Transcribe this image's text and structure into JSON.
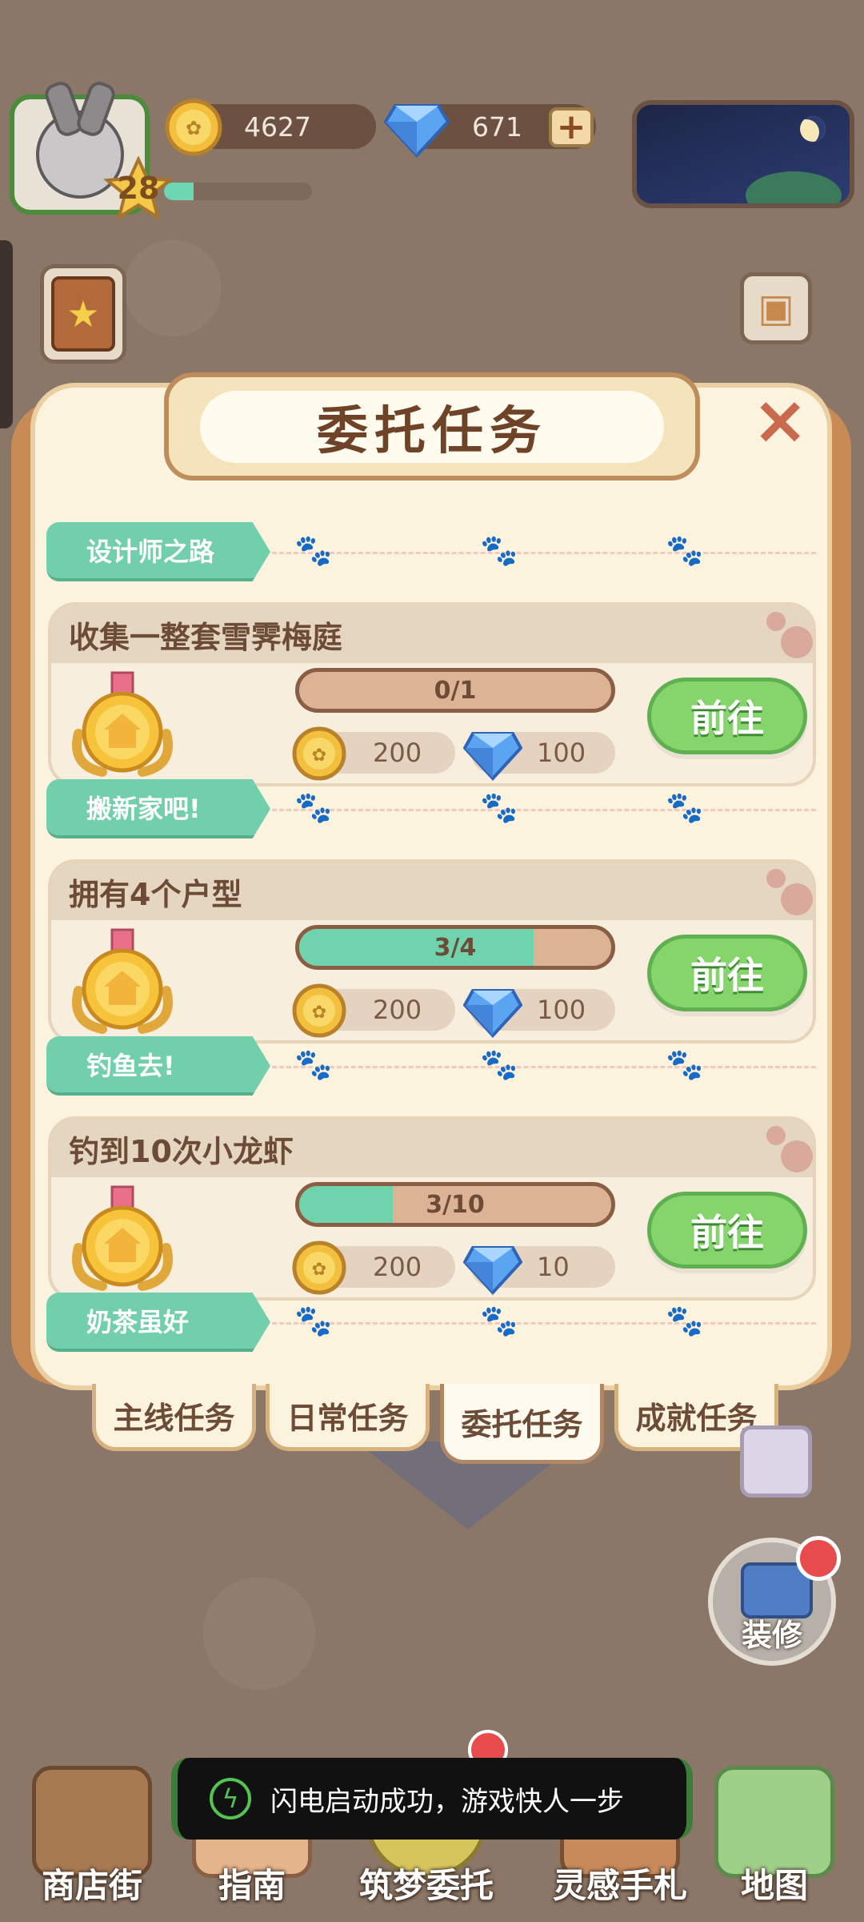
{
  "hud": {
    "level": "28",
    "xp_progress": 0.2,
    "coins": "4627",
    "gems": "671",
    "plus_label": "+"
  },
  "panel": {
    "title": "委托任务",
    "close_label": "×"
  },
  "sections": [
    {
      "tag": "设计师之路"
    },
    {
      "tag": "搬新家吧!"
    },
    {
      "tag": "钓鱼去!"
    },
    {
      "tag": "奶茶虽好"
    }
  ],
  "tasks": [
    {
      "title": "收集一整套雪霁梅庭",
      "progress_text": "0/1",
      "progress": 0.0,
      "coin_reward": "200",
      "gem_reward": "100",
      "button": "前往"
    },
    {
      "title": "拥有4个户型",
      "progress_text": "3/4",
      "progress": 0.75,
      "coin_reward": "200",
      "gem_reward": "100",
      "button": "前往"
    },
    {
      "title": "钓到10次小龙虾",
      "progress_text": "3/10",
      "progress": 0.3,
      "coin_reward": "200",
      "gem_reward": "10",
      "button": "前往"
    }
  ],
  "tabs": [
    {
      "label": "主线任务"
    },
    {
      "label": "日常任务"
    },
    {
      "label": "委托任务",
      "active": true
    },
    {
      "label": "成就任务"
    }
  ],
  "side": {
    "decorate_label": "装修"
  },
  "nav": [
    {
      "label": "商店街",
      "icon": "shop-icon"
    },
    {
      "label": "指南",
      "icon": "guide-icon"
    },
    {
      "label": "筑梦委托",
      "icon": "dream-commission-icon"
    },
    {
      "label": "灵感手札",
      "icon": "notebook-icon"
    },
    {
      "label": "地图",
      "icon": "map-icon"
    }
  ],
  "toast": {
    "text": "闪电启动成功，游戏快人一步"
  },
  "colors": {
    "accent_green": "#72cfab",
    "button_green": "#86d56c",
    "panel_bg": "#fcf3df",
    "title_brown": "#6e4328"
  }
}
